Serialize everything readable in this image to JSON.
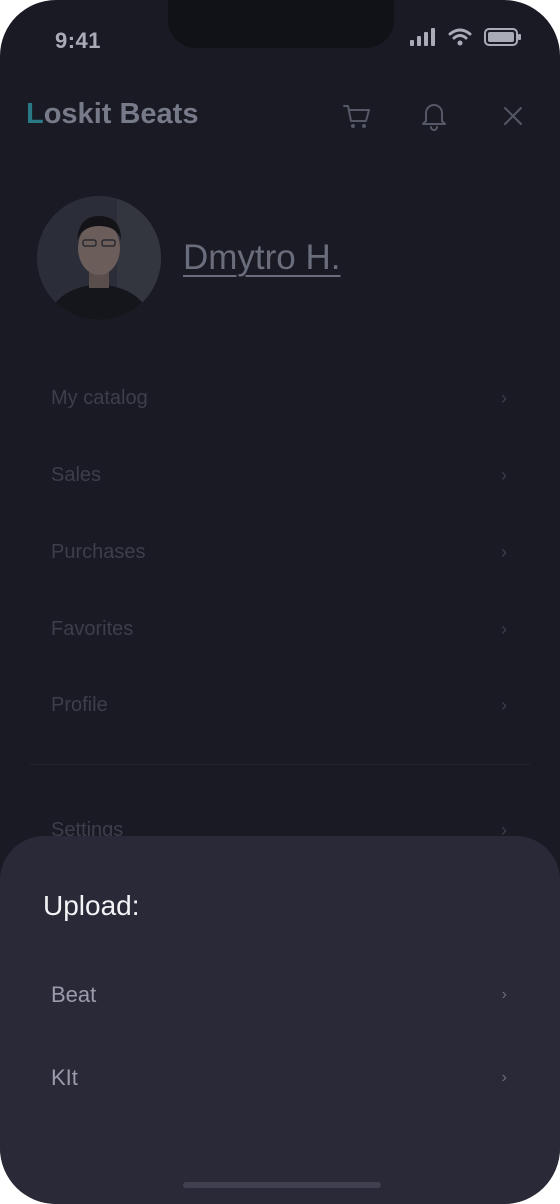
{
  "status_bar": {
    "time": "9:41"
  },
  "header": {
    "brand_first": "L",
    "brand_rest": "oskit Beats",
    "icons": [
      "cart-icon",
      "bell-icon",
      "close-icon"
    ]
  },
  "profile": {
    "name": "Dmytro H."
  },
  "menu": {
    "items": [
      {
        "label": "My catalog"
      },
      {
        "label": "Sales"
      },
      {
        "label": "Purchases"
      },
      {
        "label": "Favorites"
      },
      {
        "label": "Profile"
      },
      {
        "label": "Settings"
      }
    ]
  },
  "sheet": {
    "title": "Upload:",
    "items": [
      {
        "label": "Beat"
      },
      {
        "label": "KIt"
      }
    ]
  },
  "colors": {
    "background": "#1a1a24",
    "sheet": "#292938",
    "accent": "#2a7a86"
  }
}
